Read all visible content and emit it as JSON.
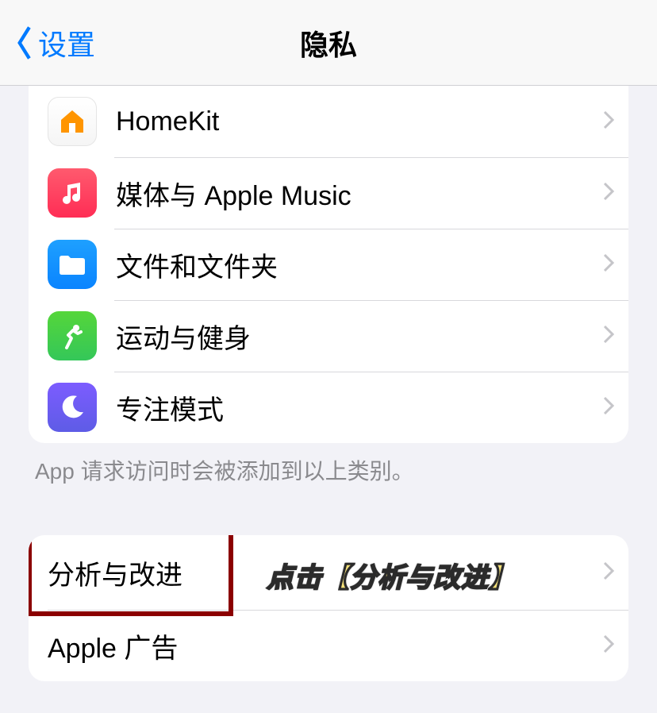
{
  "nav": {
    "back_label": "设置",
    "title": "隐私"
  },
  "group1": {
    "items": [
      {
        "label": "HomeKit"
      },
      {
        "label": "媒体与 Apple Music"
      },
      {
        "label": "文件和文件夹"
      },
      {
        "label": "运动与健身"
      },
      {
        "label": "专注模式"
      }
    ],
    "footer": "App 请求访问时会被添加到以上类别。"
  },
  "group2": {
    "items": [
      {
        "label": "分析与改进"
      },
      {
        "label": "Apple 广告"
      }
    ]
  },
  "annotation": {
    "callout": "点击【分析与改进】"
  }
}
